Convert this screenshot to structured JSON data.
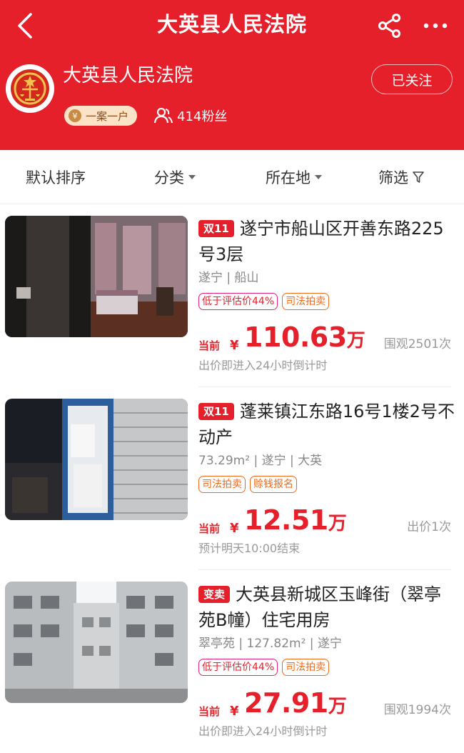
{
  "header": {
    "title": "大英县人民法院",
    "back_icon": "chevron-left-icon",
    "share_icon": "share-icon",
    "more_icon": "more-dots-icon"
  },
  "profile": {
    "name": "大英县人民法院",
    "follow_label": "已关注",
    "badge_label": "一案一户",
    "badge_coin": "¥",
    "fans": "414粉丝"
  },
  "filters": {
    "sort": "默认排序",
    "category": "分类",
    "location": "所在地",
    "filter": "筛选"
  },
  "listings": [
    {
      "type_tag": "双11",
      "title": "遂宁市船山区开善东路225号3层",
      "location": "遂宁 | 船山",
      "tags": [
        "低于评估价44%",
        "司法拍卖"
      ],
      "price_label": "当前",
      "currency": "¥",
      "price": "110.63",
      "unit": "万",
      "views": "围观2501次",
      "note": "出价即进入24小时倒计时"
    },
    {
      "type_tag": "双11",
      "title": "蓬莱镇江东路16号1楼2号不动产",
      "location": "73.29m² | 遂宁 | 大英",
      "tags": [
        "司法拍卖",
        "赊钱报名"
      ],
      "price_label": "当前",
      "currency": "¥",
      "price": "12.51",
      "unit": "万",
      "views": "出价1次",
      "note": "预计明天10:00结束"
    },
    {
      "type_tag": "变卖",
      "title": "大英县新城区玉峰街（翠亭苑B幢）住宅用房",
      "location": "翠亭苑 | 127.82m² | 遂宁",
      "tags": [
        "低于评估价44%",
        "司法拍卖"
      ],
      "price_label": "当前",
      "currency": "¥",
      "price": "27.91",
      "unit": "万",
      "views": "围观1994次",
      "note": "出价即进入24小时倒计时"
    }
  ],
  "colors": {
    "brand_red": "#e5202b",
    "orange": "#f06a1a",
    "pink": "#e5207a"
  }
}
